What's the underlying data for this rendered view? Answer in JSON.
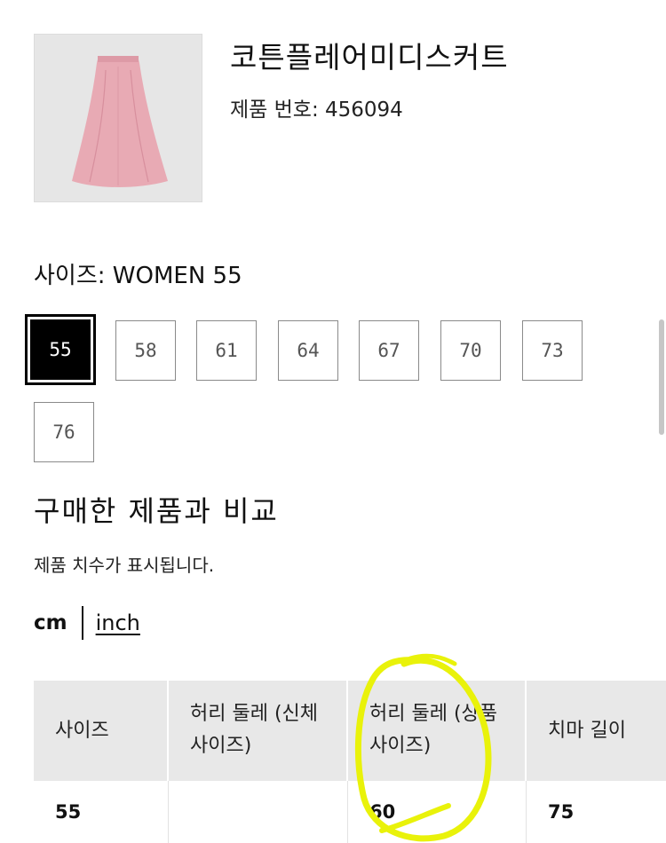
{
  "product": {
    "title": "코튼플레어미디스커트",
    "number_text": "제품 번호: 456094",
    "image_icon": "pink-flare-skirt-image"
  },
  "size_section": {
    "label": "사이즈: WOMEN 55",
    "options": [
      "55",
      "58",
      "61",
      "64",
      "67",
      "70",
      "73",
      "76"
    ],
    "selected": "55"
  },
  "compare": {
    "heading": "구매한 제품과 비교",
    "subtext": "제품 치수가 표시됩니다.",
    "units": {
      "cm": "cm",
      "inch": "inch",
      "active": "cm"
    }
  },
  "size_table": {
    "headers": [
      "사이즈",
      "허리 둘레 (신체 사이즈)",
      "허리 둘레 (상품 사이즈)",
      "치마 길이"
    ],
    "rows": [
      [
        "55",
        "",
        "60",
        "75"
      ]
    ]
  },
  "colors": {
    "annotation_circle": "#e9f20a",
    "skirt": "#e8aab4",
    "table_header_bg": "#e8e8e8",
    "selected_size_bg": "#000000"
  }
}
